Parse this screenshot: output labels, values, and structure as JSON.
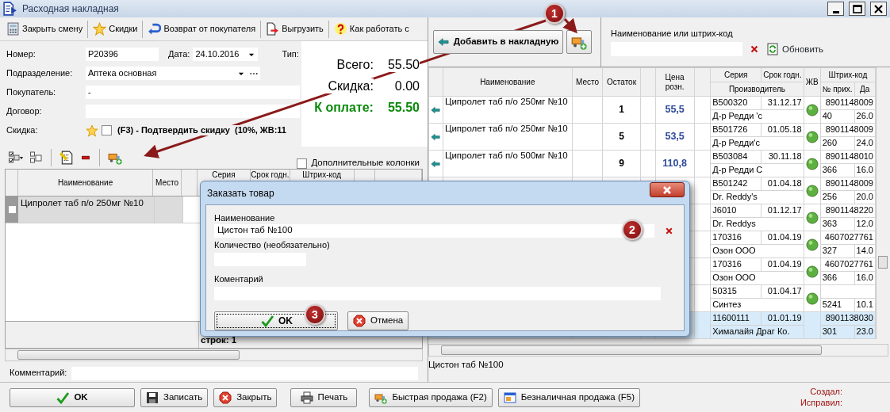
{
  "window": {
    "title": "Расходная накладная"
  },
  "toolbar": [
    {
      "label": "Закрыть смену",
      "kind": "calculator"
    },
    {
      "label": "Скидки",
      "kind": "star"
    },
    {
      "label": "Возврат от покупателя",
      "kind": "return"
    },
    {
      "label": "Выгрузить",
      "kind": "export"
    },
    {
      "label": "Как работать с",
      "kind": "help"
    }
  ],
  "form": {
    "number": {
      "label": "Номер:",
      "value": "P20396"
    },
    "date": {
      "label": "Дата:",
      "value": "24.10.2016"
    },
    "type": {
      "label": "Тип:"
    },
    "department": {
      "label": "Подразделение:",
      "value": "Аптека основная"
    },
    "buyer": {
      "label": "Покупатель:",
      "value": "-"
    },
    "contract": {
      "label": "Договор:"
    },
    "discount": {
      "label": "Скидка:",
      "checked": false,
      "text": "(F3) - Подтвердить скидку  (10%, ЖВ:11"
    }
  },
  "totals": [
    {
      "label": "Всего:",
      "value": "55.50",
      "kind": "plain"
    },
    {
      "label": "Скидка:",
      "value": "0.00",
      "kind": "plain"
    },
    {
      "label": "К оплате:",
      "value": "55.50",
      "kind": "due"
    }
  ],
  "extra_columns": {
    "label": "Дополнительные колонки",
    "checked": false
  },
  "items_table": {
    "columns": {
      "name": "Наименование",
      "place": "Место",
      "series": "Серия",
      "expiry": "Срок годн.",
      "barcode": "Штрих-код"
    },
    "rows": [
      {
        "name": "Ципролет таб п/о 250мг №10",
        "selected": true
      }
    ],
    "footer": "строк: 1"
  },
  "comment": {
    "label": "Комментарий:"
  },
  "stock": {
    "add_button": "Добавить в накладную",
    "search": {
      "label": "Наименование или штрих-код"
    },
    "refresh": "Обновить",
    "columns": {
      "name": "Наименование",
      "place": "Место",
      "stock": "Остаток",
      "price": "Цена розн.",
      "series": "Серия",
      "expiry": "Срок годн.",
      "maker": "Производитель",
      "vital": "ЖВ",
      "barcode": "Штрих-код",
      "receipt": "№ прих.",
      "date": "Да"
    },
    "rows": [
      {
        "name": "Ципролет таб п/о 250мг №10",
        "stock": "1",
        "price": "55,5",
        "series": "B500320",
        "expiry": "31.12.17",
        "maker": "Д-р Редди 'с",
        "vital": true,
        "barcode": "8901148009",
        "receipt": "40",
        "date": "26.0",
        "selected": false
      },
      {
        "name": "Ципролет таб п/о 250мг №10",
        "stock": "5",
        "price": "53,5",
        "series": "B501726",
        "expiry": "01.05.18",
        "maker": "Д-р Редди'с",
        "vital": true,
        "barcode": "8901148009",
        "receipt": "260",
        "date": "24.0",
        "selected": false
      },
      {
        "name": "Ципролет таб п/о 500мг №10",
        "stock": "9",
        "price": "110,8",
        "series": "B503084",
        "expiry": "30.11.18",
        "maker": "Д-р Редди С",
        "vital": true,
        "barcode": "8901148010",
        "receipt": "366",
        "date": "16.0",
        "selected": false
      },
      {
        "series": "B501242",
        "expiry": "01.04.18",
        "maker": "Dr. Reddy's",
        "vital": true,
        "barcode": "8901148009",
        "receipt": "256",
        "date": "20.0",
        "selected": false
      },
      {
        "series": "J6010",
        "expiry": "01.12.17",
        "maker": "Dr. Reddys",
        "vital": true,
        "barcode": "8901148220",
        "receipt": "363",
        "date": "12.0",
        "selected": false
      },
      {
        "series": "170316",
        "expiry": "01.04.19",
        "maker": "Озон ООО",
        "vital": true,
        "barcode": "4607027761",
        "receipt": "327",
        "date": "14.0",
        "selected": false
      },
      {
        "series": "170316",
        "expiry": "01.04.19",
        "maker": "Озон ООО",
        "vital": true,
        "barcode": "4607027761",
        "receipt": "366",
        "date": "16.0",
        "selected": false
      },
      {
        "series": "50315",
        "expiry": "01.04.17",
        "maker": "Синтез",
        "vital": true,
        "receipt": "5241",
        "date": "10.1",
        "selected": false
      },
      {
        "series": "11600111",
        "expiry": "01.01.19",
        "maker": "Хималайя Драг Ко.",
        "vital": false,
        "barcode": "8901138030",
        "receipt": "301",
        "date": "23.0",
        "selected": true
      }
    ],
    "status": "Цистон таб №100"
  },
  "dialog": {
    "title": "Заказать товар",
    "name": {
      "label": "Наименование",
      "value": "Цистон таб №100"
    },
    "quantity": {
      "label": "Количество (необязательно)"
    },
    "comment": {
      "label": "Коментарий"
    },
    "ok": "OK",
    "cancel": "Отмена"
  },
  "buttons": [
    {
      "label": "OK",
      "kind": "ok"
    },
    {
      "label": "Записать",
      "kind": "save"
    },
    {
      "label": "Закрыть",
      "kind": "close"
    },
    {
      "label": "Печать",
      "kind": "print"
    },
    {
      "label": "Быстрая продажа (F2)",
      "kind": "quick"
    },
    {
      "label": "Безналичная продажа (F5)",
      "kind": "cashless"
    }
  ],
  "audit": {
    "created": "Создал:",
    "edited": "Исправил:"
  },
  "markers": [
    "1",
    "2",
    "3"
  ]
}
